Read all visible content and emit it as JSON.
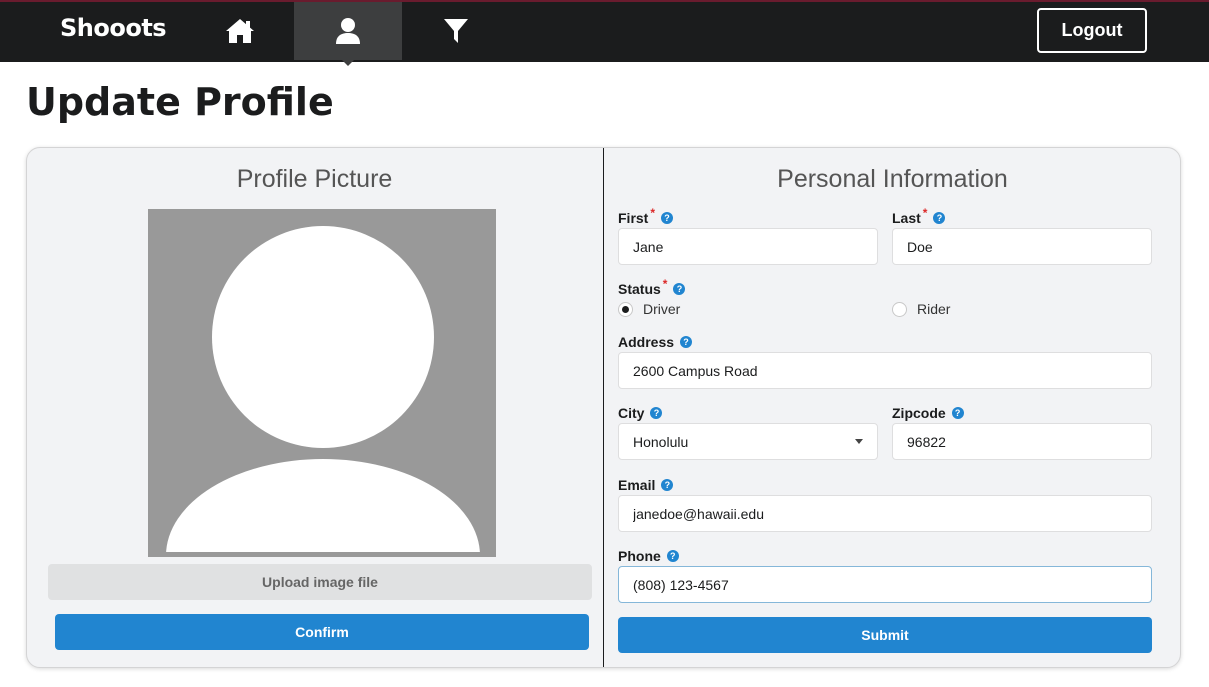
{
  "nav": {
    "brand": "Shooots",
    "logout_label": "Logout",
    "icons": [
      "home-icon",
      "user-icon",
      "filter-icon"
    ]
  },
  "page": {
    "title": "Update Profile"
  },
  "picture": {
    "title": "Profile Picture",
    "upload_label": "Upload image file",
    "confirm_label": "Confirm"
  },
  "info": {
    "title": "Personal Information",
    "first": {
      "label": "First",
      "value": "Jane"
    },
    "last": {
      "label": "Last",
      "value": "Doe"
    },
    "status": {
      "label": "Status",
      "options": [
        "Driver",
        "Rider"
      ],
      "selected": "Driver"
    },
    "address": {
      "label": "Address",
      "value": "2600 Campus Road"
    },
    "city": {
      "label": "City",
      "value": "Honolulu"
    },
    "zipcode": {
      "label": "Zipcode",
      "value": "96822"
    },
    "email": {
      "label": "Email",
      "value": "janedoe@hawaii.edu"
    },
    "phone": {
      "label": "Phone",
      "value": "(808) 123-4567"
    },
    "submit_label": "Submit"
  },
  "colors": {
    "primary": "#2185d0",
    "navbar": "#1b1c1d",
    "required": "#db2828"
  }
}
